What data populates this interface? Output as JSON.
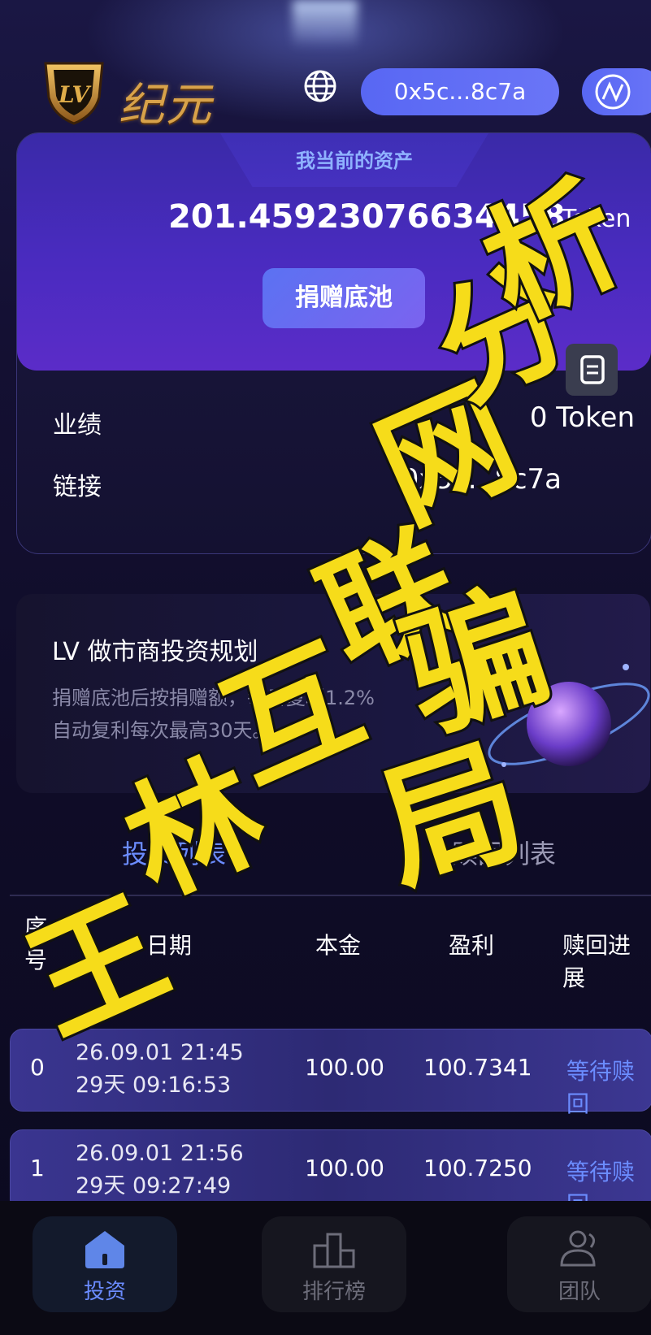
{
  "header": {
    "brand": "纪元",
    "logo_text": "LV",
    "wallet_address": "0x5c...8c7a"
  },
  "asset_card": {
    "title": "我当前的资产",
    "amount": "201.45923076634458",
    "unit": "Token",
    "donate_label": "捐赠底池",
    "performance_label": "业绩",
    "performance_value": "0 Token",
    "link_label": "链接",
    "link_value": "0x5c...8c7a"
  },
  "plan": {
    "title": "LV 做市商投资规划",
    "description": "捐赠底池后按捐赠额，每日复利1.2%自动复利每次最高30天。"
  },
  "tabs": {
    "active": "投资列表",
    "inactive": "赎回列表"
  },
  "table": {
    "headers": [
      "序号",
      "日期",
      "本金",
      "盈利",
      "赎回进展"
    ],
    "rows": [
      {
        "index": "0",
        "date": "26.09.01 21:45",
        "remain": "29天 09:16:53",
        "principal": "100.00",
        "profit": "100.7341",
        "status": "等待赎回"
      },
      {
        "index": "1",
        "date": "26.09.01 21:56",
        "remain": "29天 09:27:49",
        "principal": "100.00",
        "profit": "100.7250",
        "status": "等待赎回"
      }
    ]
  },
  "bottom_nav": [
    {
      "label": "投资",
      "icon": "home-icon",
      "active": true
    },
    {
      "label": "排行榜",
      "icon": "podium-icon",
      "active": false
    },
    {
      "label": "团队",
      "icon": "team-icon",
      "active": false
    }
  ],
  "watermark": {
    "line1": "王林互联网分析",
    "line2": "骗局"
  },
  "colors": {
    "accent": "#6b8cff",
    "watermark": "#f6dc1a"
  }
}
